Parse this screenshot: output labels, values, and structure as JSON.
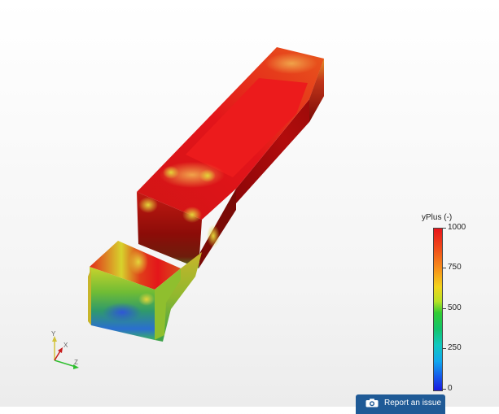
{
  "legend": {
    "title": "yPlus (-)",
    "ticks": [
      "1000",
      "750",
      "500",
      "250",
      "0"
    ]
  },
  "report_button": {
    "label": "Report an issue"
  },
  "axes": {
    "labels": [
      "Y",
      "Z",
      "X"
    ]
  },
  "colors": {
    "high": "#e8141a",
    "dark_red": "#7a0000",
    "orange": "#f08a2a",
    "yellow": "#d7d32c",
    "green": "#34c04a",
    "blue": "#2a6ed8",
    "button": "#1f5a96"
  }
}
